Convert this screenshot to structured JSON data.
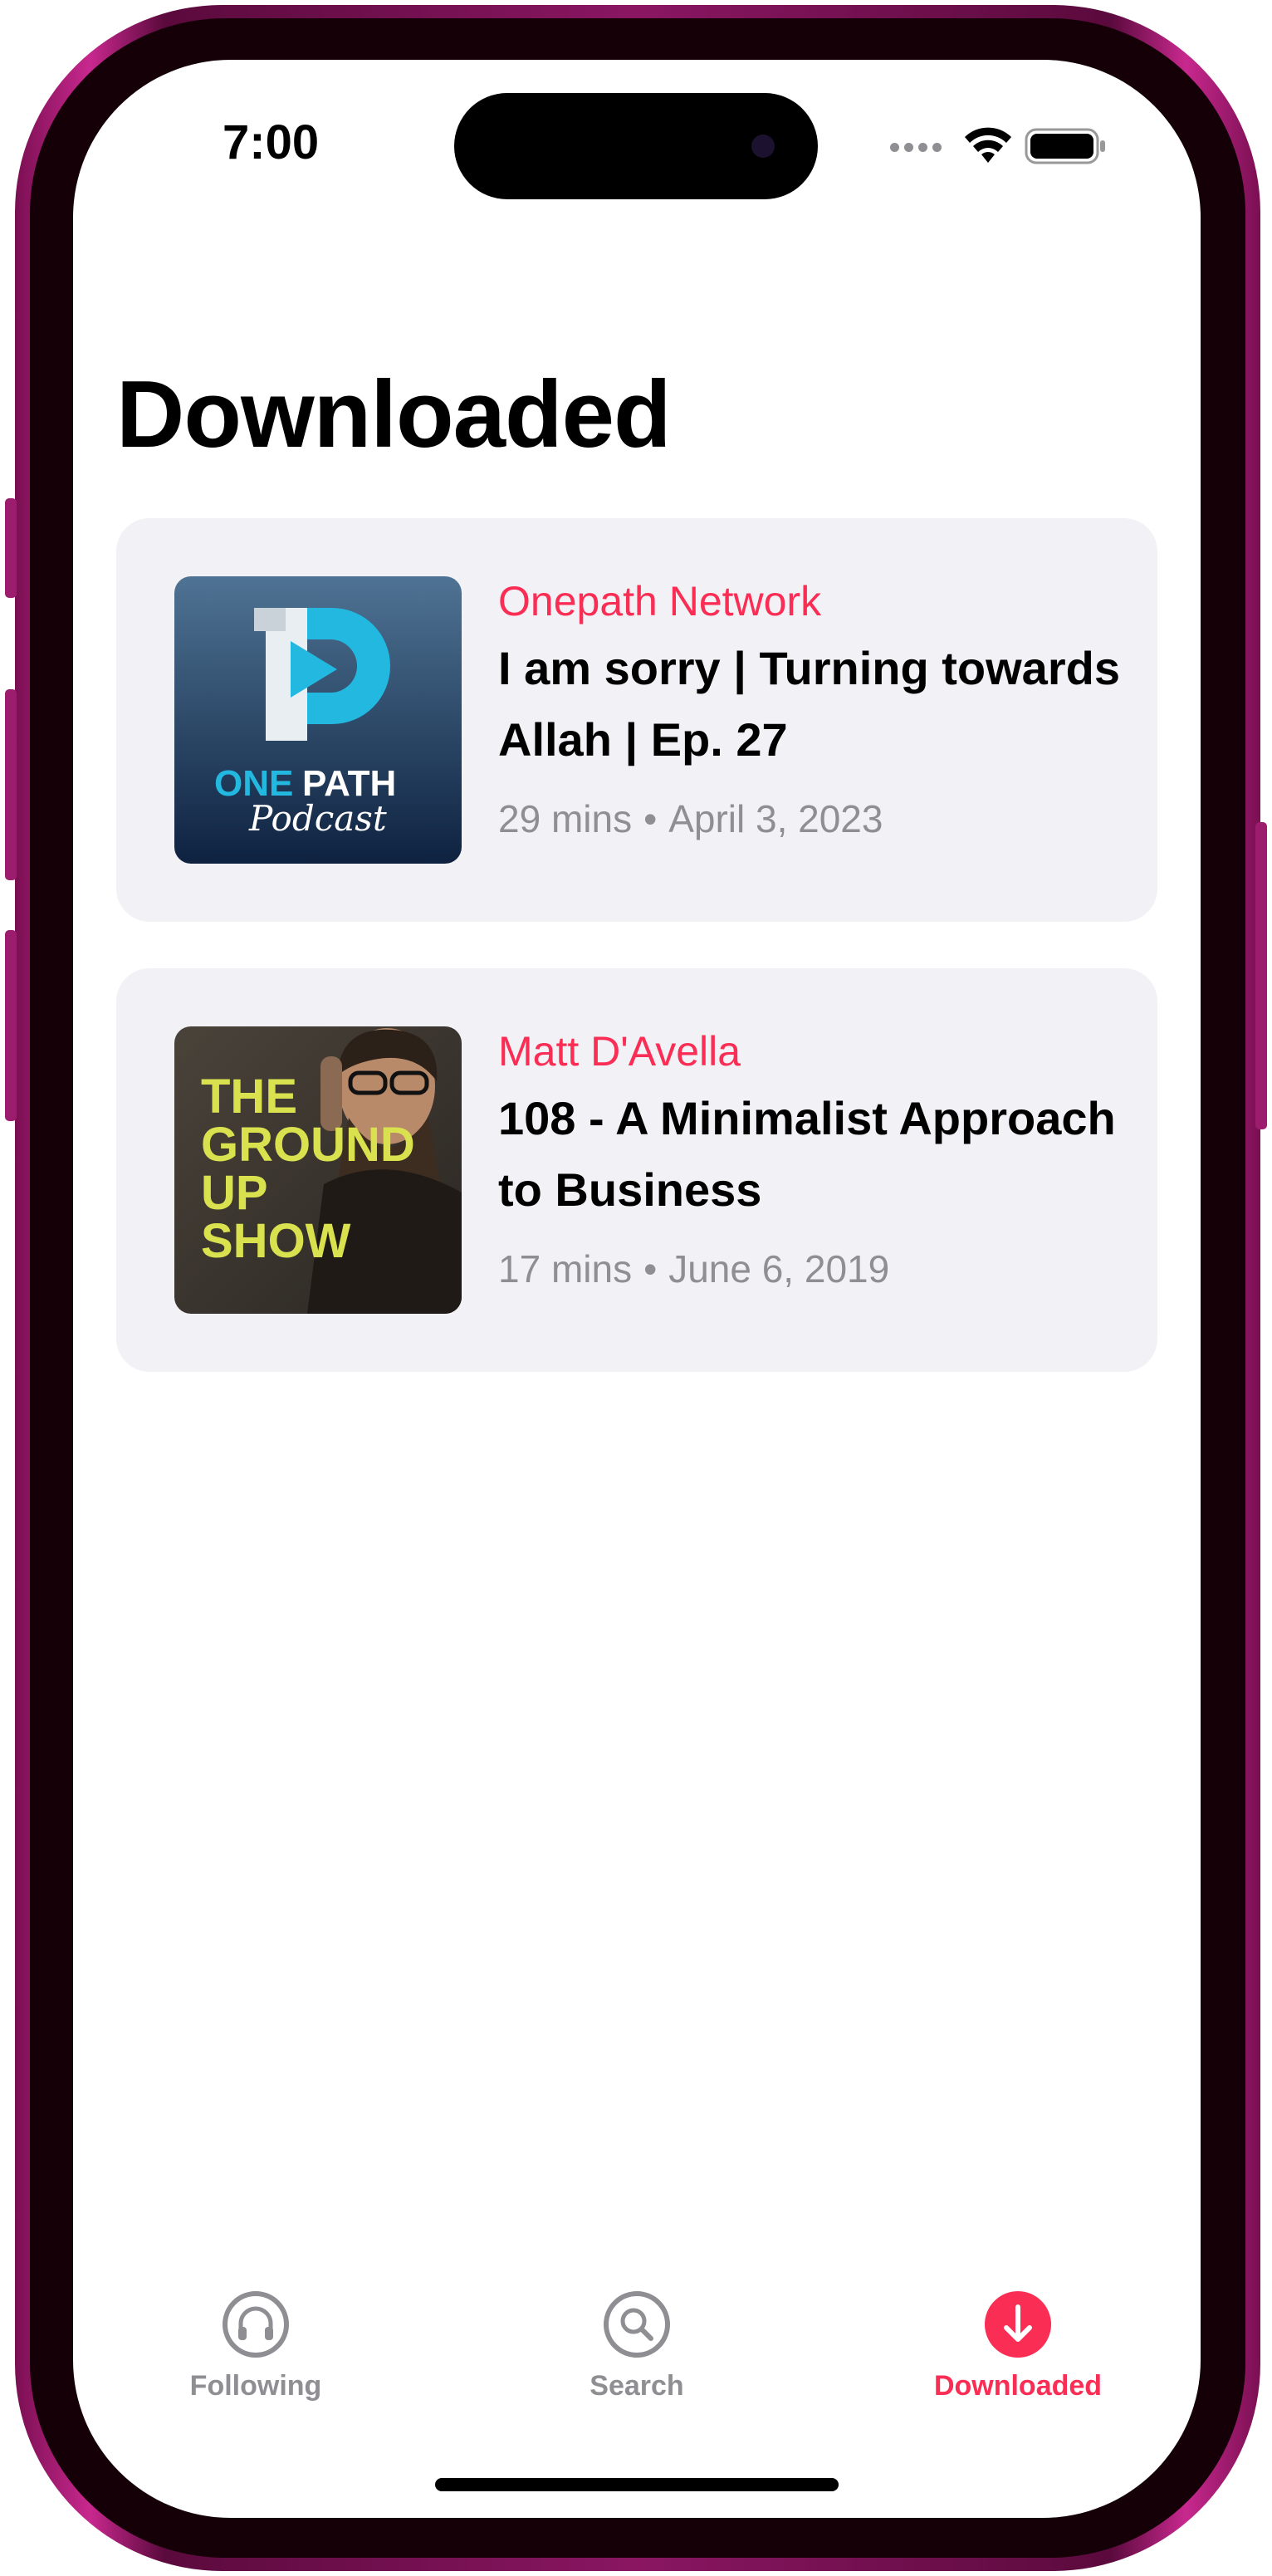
{
  "status": {
    "time": "7:00"
  },
  "page": {
    "title": "Downloaded"
  },
  "episodes": [
    {
      "show": "Onepath Network",
      "title": "I am sorry | Turning towards Allah | Ep. 27",
      "duration": "29 mins",
      "date": "April 3, 2023",
      "artwork": {
        "logo_text_1": "ONE",
        "logo_text_2": "PATH",
        "logo_text_3": "Podcast",
        "colors": [
          "#4f7394",
          "#0e2240",
          "#22b8e0"
        ]
      }
    },
    {
      "show": "Matt D'Avella",
      "title": "108 - A Minimalist Approach to Business",
      "duration": "17 mins",
      "date": "June 6, 2019",
      "artwork": {
        "line_1": "THE",
        "line_2": "GROUND",
        "line_3": "UP",
        "line_4": "SHOW",
        "colors": [
          "#3b362f",
          "#d9e24e"
        ]
      }
    }
  ],
  "tabs": [
    {
      "label": "Following",
      "icon": "headphones-icon",
      "active": false
    },
    {
      "label": "Search",
      "icon": "search-icon",
      "active": false
    },
    {
      "label": "Downloaded",
      "icon": "download-icon",
      "active": true
    }
  ],
  "colors": {
    "accent": "#fa2d55",
    "card": "#f2f1f6",
    "secondary": "#8e8e93"
  }
}
